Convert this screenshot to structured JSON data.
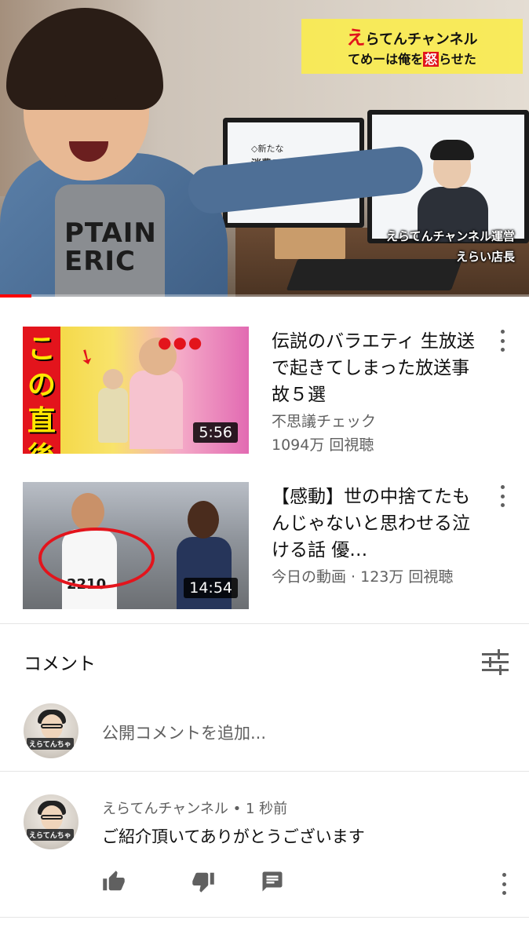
{
  "player": {
    "overlay_channel_accent": "え",
    "overlay_channel_rest": "らてんチャンネル",
    "overlay_line2_pre": "てめーは俺を",
    "overlay_line2_hl": "怒",
    "overlay_line2_post": "らせた",
    "caption_line1": "えらてんチャンネル運営",
    "caption_line2": "えらい店長",
    "monitor_text_line1": "◇新たな",
    "monitor_text_line2": "消費スタイル",
    "shirt_text": "PTAIN\nERIC",
    "progress": 0.06,
    "progress_color": "#ff0000"
  },
  "recommendations": [
    {
      "title": "伝説のバラエティ 生放送で起きてしまった放送事故５選",
      "channel": "不思議チェック",
      "views": "1094万 回視聴",
      "duration": "5:56",
      "thumb_text": "この直後",
      "thumb_marks": "●●●"
    },
    {
      "title": "【感動】世の中捨てたもんじゃないと思わせる泣ける話 優…",
      "meta": "今日の動画 · 123万 回視聴",
      "duration": "14:54",
      "thumb_bib": "2210"
    }
  ],
  "comments": {
    "header": "コメント",
    "add_placeholder": "公開コメントを追加...",
    "avatar_tag": "えらてんちゃ",
    "items": [
      {
        "author": "えらてんチャンネル",
        "time": " • 1 秒前",
        "text": "ご紹介頂いてありがとうございます"
      }
    ]
  },
  "icons": {
    "sort": "sort-icon",
    "like": "thumbs-up-icon",
    "dislike": "thumbs-down-icon",
    "reply": "reply-icon",
    "more": "more-vert-icon"
  }
}
